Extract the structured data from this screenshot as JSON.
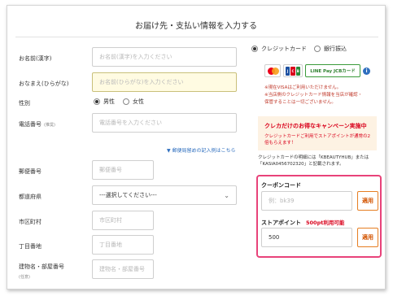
{
  "header": {
    "title": "お届け先・支払い情報を入力する"
  },
  "form": {
    "name": {
      "label": "お名前(漢字)",
      "placeholder": "お名前(漢字)を入力ください"
    },
    "kana": {
      "label": "おなまえ(ひらがな)",
      "placeholder": "お名前(ひらがな)を入力ください"
    },
    "gender": {
      "label": "性別",
      "options": [
        "男性",
        "女性"
      ],
      "selected": "男性"
    },
    "phone": {
      "label": "電話番号",
      "sub": "(推奨)",
      "placeholder": "電話番号を入力ください"
    },
    "postal_link": "▼ 郵便局留めの記入例はこちら",
    "postal": {
      "label": "郵便番号",
      "placeholder": "郵便番号"
    },
    "prefecture": {
      "label": "都道府県",
      "value": "---選択してください---"
    },
    "city": {
      "label": "市区町村",
      "placeholder": "市区町村"
    },
    "street": {
      "label": "丁目番地",
      "placeholder": "丁目番地"
    },
    "building": {
      "label": "建物名・部屋番号",
      "sub": "(任意)",
      "placeholder": "建物名・部屋番号"
    }
  },
  "payment": {
    "options": [
      "クレジットカード",
      "銀行振込"
    ],
    "selected": "クレジットカード",
    "cards": {
      "mastercard_icon": "mastercard-icon",
      "jcb_label": "JCB",
      "linepay_label": "LINE Pay JCBカード",
      "info_icon": "i"
    },
    "notes": [
      "※現在VISAはご利用いただけません。",
      "※当店側のクレジットカード情報を当店が確認・",
      "保管することは一切ございません。"
    ],
    "campaign": {
      "heading": "クレカだけのお得なキャンペーン実施中",
      "body": "クレジットカードご利用でストアポイントが通常の2倍もらえます！"
    },
    "card_statement": "クレジットカードの明細には「KBEAUTYHUB」または「KASIA0456702320」と記載されます。"
  },
  "promo": {
    "coupon": {
      "label": "クーポンコード",
      "placeholder": "例：bk39",
      "button": "適用"
    },
    "points": {
      "label": "ストアポイント",
      "available": "500pt利用可能",
      "value": "500",
      "button": "適用"
    }
  },
  "colors": {
    "accent": "#e8437a",
    "alert": "#d9001b",
    "apply_border": "#e67e22",
    "link": "#2f6fbf",
    "highlight_input": "#fffbe2"
  }
}
